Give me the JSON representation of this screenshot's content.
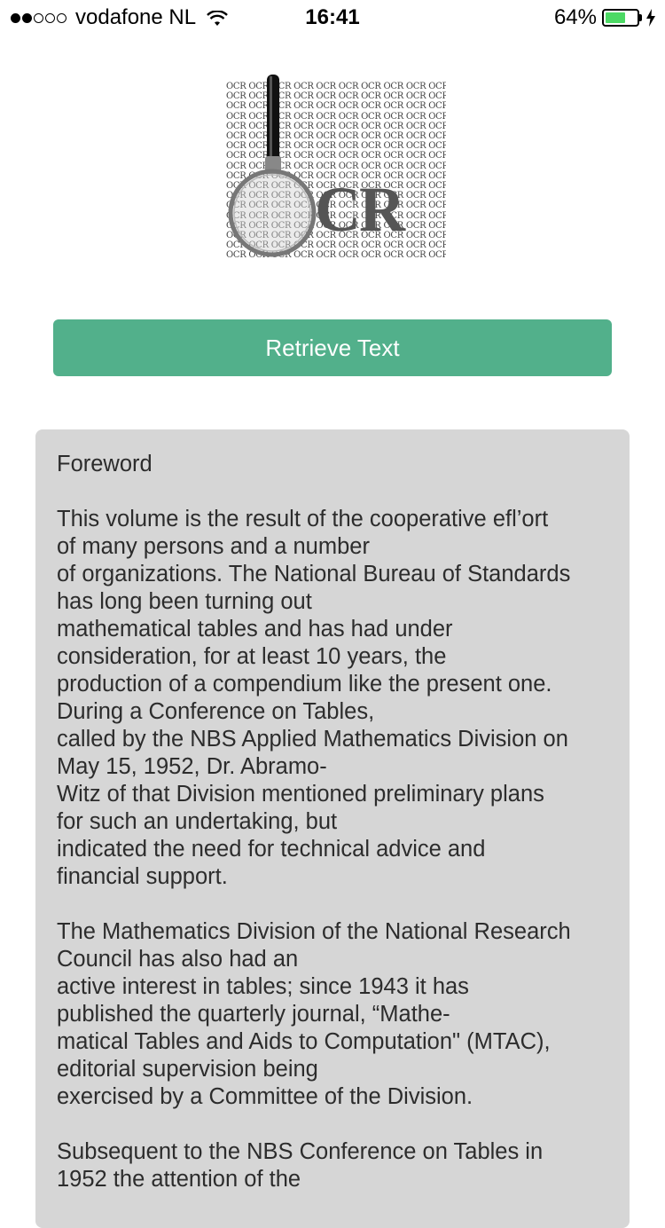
{
  "status_bar": {
    "signal_dots_filled": 2,
    "signal_dots_total": 5,
    "carrier": "vodafone NL",
    "wifi_icon": "wifi-icon",
    "time": "16:41",
    "battery_percent_label": "64%",
    "battery_level": 0.64,
    "battery_color": "#4cd964",
    "charging_icon": "bolt-icon"
  },
  "logo": {
    "icon": "ocr-magnifier-logo",
    "grid_word": "OCR",
    "big_text": "CR"
  },
  "actions": {
    "retrieve_label": "Retrieve Text",
    "retrieve_color": "#52b08b"
  },
  "result": {
    "background": "#d6d6d6",
    "text": "Foreword\n\nThis volume is the result of the cooperative efl’ort\nof many persons and a number\nof organizations. The National Bureau of Standards\nhas long been turning out\nmathematical tables and has had under\nconsideration, for at least 10 years, the\nproduction of a compendium like the present one.\nDuring a Conference on Tables,\ncalled by the NBS Applied Mathematics Division on\nMay 15, 1952, Dr. Abramo-\nWitz of that Division mentioned preliminary plans\nfor such an undertaking, but\nindicated the need for technical advice and\nfinancial support.\n\nThe Mathematics Division of the National Research\nCouncil has also had an\nactive interest in tables; since 1943 it has\npublished the quarterly journal, “Mathe-\nmatical Tables and Aids to Computation\" (MTAC),\neditorial supervision being\nexercised by a Committee of the Division.\n\nSubsequent to the NBS Conference on Tables in\n1952 the attention of the"
  }
}
